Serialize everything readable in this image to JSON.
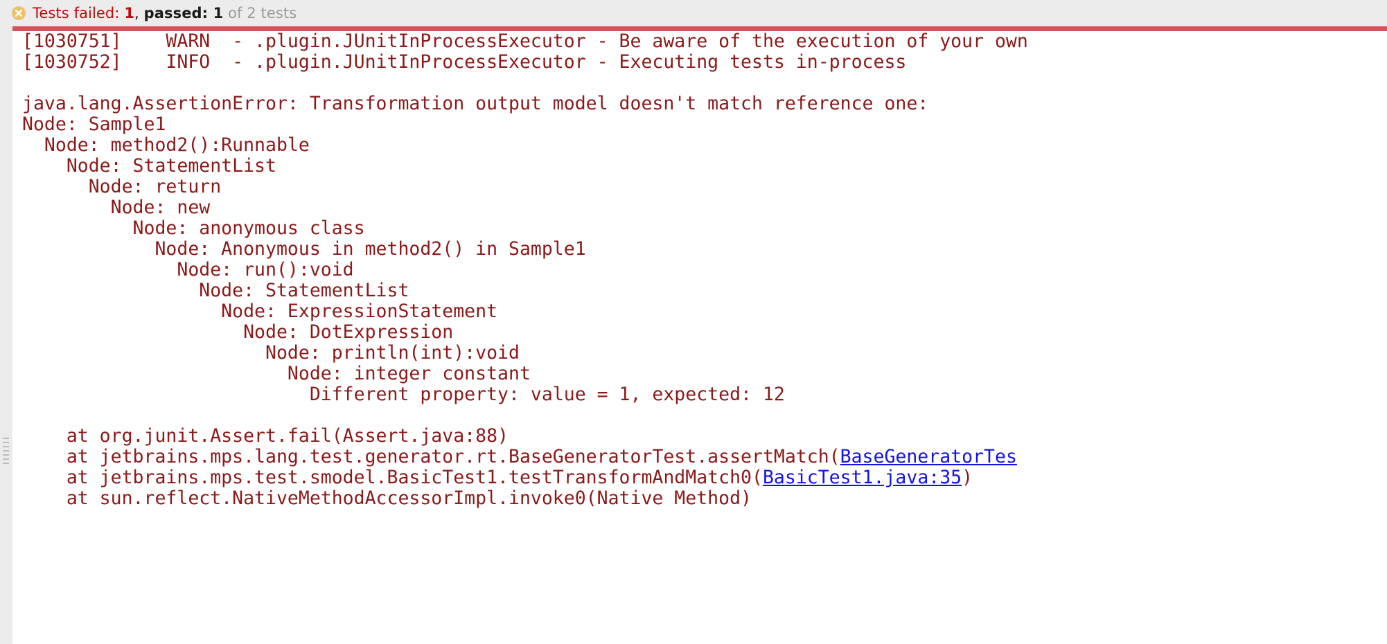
{
  "header": {
    "icon": "error-circle-x-icon",
    "icon_fill": "#e9c36a",
    "icon_glyph": "#ffffff",
    "failed_label": "Tests failed: ",
    "failed_count": "1",
    "separator": ", ",
    "passed_label": "passed: ",
    "passed_count": "1",
    "total_text": " of 2 tests",
    "failed_color": "#c00a0a",
    "passed_color": "#1a1a1a",
    "total_color": "#9a9a9a",
    "background": "#ececec"
  },
  "separator_bar": {
    "color": "#cf5658"
  },
  "gutter": {
    "color": "#ebebeb",
    "handle": "drag-handle-dots"
  },
  "console": {
    "text_color": "#8b1a1a",
    "link_color": "#1414e0",
    "background": "#ffffff",
    "lines": [
      {
        "id": "log-warn",
        "text": "[1030751]    WARN  - .plugin.JUnitInProcessExecutor - Be aware of the execution of your own"
      },
      {
        "id": "log-info",
        "text": "[1030752]    INFO  - .plugin.JUnitInProcessExecutor - Executing tests in-process"
      },
      {
        "id": "blank-1",
        "text": ""
      },
      {
        "id": "assertion-error",
        "text": "java.lang.AssertionError: Transformation output model doesn't match reference one:"
      },
      {
        "id": "node-sample1",
        "text": "Node: Sample1"
      },
      {
        "id": "node-method2",
        "text": "  Node: method2():Runnable"
      },
      {
        "id": "node-statementlist-1",
        "text": "    Node: StatementList"
      },
      {
        "id": "node-return",
        "text": "      Node: return"
      },
      {
        "id": "node-new",
        "text": "        Node: new"
      },
      {
        "id": "node-anonymous-class",
        "text": "          Node: anonymous class"
      },
      {
        "id": "node-anonymous-in-method2",
        "text": "            Node: Anonymous in method2() in Sample1"
      },
      {
        "id": "node-run",
        "text": "              Node: run():void"
      },
      {
        "id": "node-statementlist-2",
        "text": "                Node: StatementList"
      },
      {
        "id": "node-expressionstatement",
        "text": "                  Node: ExpressionStatement"
      },
      {
        "id": "node-dotexpression",
        "text": "                    Node: DotExpression"
      },
      {
        "id": "node-println",
        "text": "                      Node: println(int):void"
      },
      {
        "id": "node-integer-constant",
        "text": "                        Node: integer constant"
      },
      {
        "id": "node-different-property",
        "text": "                          Different property: value = 1, expected: 12"
      },
      {
        "id": "blank-2",
        "text": ""
      },
      {
        "id": "stack-assert-fail",
        "text": "    at org.junit.Assert.fail(Assert.java:88)"
      },
      {
        "id": "stack-assertmatch",
        "prefix": "    at jetbrains.mps.lang.test.generator.rt.BaseGeneratorTest.assertMatch(",
        "link": "BaseGeneratorTes",
        "suffix": ""
      },
      {
        "id": "stack-testtransformandmatch0",
        "prefix": "    at jetbrains.mps.test.smodel.BasicTest1.testTransformAndMatch0(",
        "link": "BasicTest1.java:35",
        "suffix": ")"
      },
      {
        "id": "stack-nativemethod",
        "text": "    at sun.reflect.NativeMethodAccessorImpl.invoke0(Native Method)"
      }
    ]
  }
}
